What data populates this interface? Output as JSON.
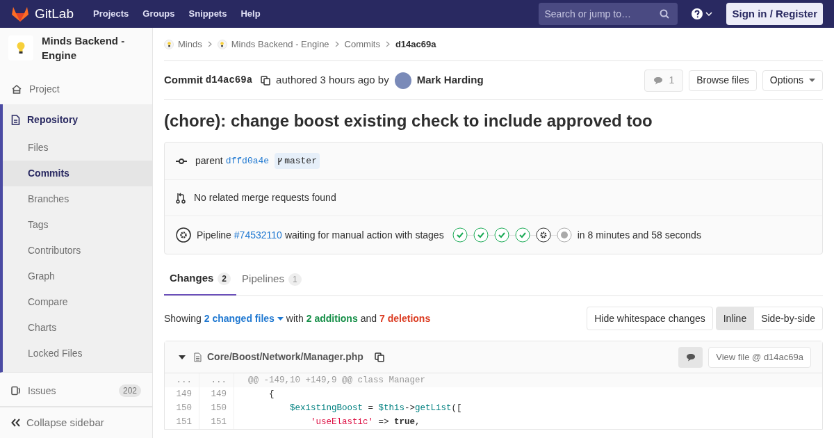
{
  "header": {
    "logo": "GitLab",
    "nav": [
      "Projects",
      "Groups",
      "Snippets",
      "Help"
    ],
    "search": {
      "placeholder": "Search or jump to…"
    },
    "sign_in": "Sign in / Register"
  },
  "sidebar": {
    "project": "Minds Backend - Engine",
    "items": [
      {
        "label": "Project",
        "selected": false
      },
      {
        "label": "Repository",
        "selected": true,
        "children": [
          {
            "label": "Files",
            "selected": false
          },
          {
            "label": "Commits",
            "selected": true
          },
          {
            "label": "Branches",
            "selected": false
          },
          {
            "label": "Tags",
            "selected": false
          },
          {
            "label": "Contributors",
            "selected": false
          },
          {
            "label": "Graph",
            "selected": false
          },
          {
            "label": "Compare",
            "selected": false
          },
          {
            "label": "Charts",
            "selected": false
          },
          {
            "label": "Locked Files",
            "selected": false
          }
        ]
      },
      {
        "label": "Issues",
        "selected": false,
        "count": "202"
      }
    ],
    "collapse": "Collapse sidebar"
  },
  "breadcrumbs": [
    {
      "label": "Minds",
      "avatar": true
    },
    {
      "label": "Minds Backend - Engine",
      "avatar": true
    },
    {
      "label": "Commits",
      "avatar": false
    },
    {
      "label": "d14ac69a",
      "avatar": false
    }
  ],
  "commit": {
    "label": "Commit",
    "sha": "d14ac69a",
    "authored": "authored 3 hours ago by",
    "author": "Mark Harding",
    "comments": "1",
    "browse": "Browse files",
    "options": "Options",
    "title": "(chore): change boost existing check to include approved too"
  },
  "info": {
    "parent_label": "parent",
    "parent_sha": "dffd0a4e",
    "branch": "master",
    "merge_requests": "No related merge requests found",
    "pipeline": {
      "label": "Pipeline",
      "id": "#74532110",
      "status": "waiting for manual action with stages",
      "duration": "in 8 minutes and 58 seconds",
      "stages": [
        {
          "kind": "success"
        },
        {
          "kind": "success"
        },
        {
          "kind": "success"
        },
        {
          "kind": "success"
        },
        {
          "kind": "manual"
        },
        {
          "kind": "created"
        }
      ]
    }
  },
  "tabs": [
    {
      "label": "Changes",
      "count": "2",
      "selected": true
    },
    {
      "label": "Pipelines",
      "count": "1",
      "selected": false
    }
  ],
  "summary": {
    "showing": "Showing",
    "files": "2 changed files",
    "with": "with",
    "additions": "2 additions",
    "and": "and",
    "deletions": "7 deletions"
  },
  "view": {
    "whitespace": "Hide whitespace changes",
    "modes": [
      {
        "label": "Inline",
        "selected": true
      },
      {
        "label": "Side-by-side",
        "selected": false
      }
    ]
  },
  "file": {
    "path": "Core/Boost/Network/Manager.php",
    "view_file": "View file @ d14ac69a",
    "lines": [
      {
        "kind": "match",
        "old": "...",
        "new": "...",
        "tokens": [
          {
            "text": "@@ -149,10 +149,9 @@ class Manager"
          }
        ]
      },
      {
        "kind": "context",
        "old": "149",
        "new": "149",
        "tokens": [
          {
            "text": "    {"
          }
        ]
      },
      {
        "kind": "context",
        "old": "150",
        "new": "150",
        "tokens": [
          {
            "text": "        $existingBoost",
            "color": "#008080"
          },
          {
            "text": " = "
          },
          {
            "text": "$this",
            "color": "#008080"
          },
          {
            "text": "->"
          },
          {
            "text": "getList",
            "color": "#008080"
          },
          {
            "text": "(["
          }
        ]
      },
      {
        "kind": "context",
        "old": "151",
        "new": "151",
        "tokens": [
          {
            "text": "            'useElastic'",
            "color": "#dd1144"
          },
          {
            "text": " => "
          },
          {
            "text": "true",
            "bold": true
          },
          {
            "text": ","
          }
        ]
      }
    ]
  }
}
